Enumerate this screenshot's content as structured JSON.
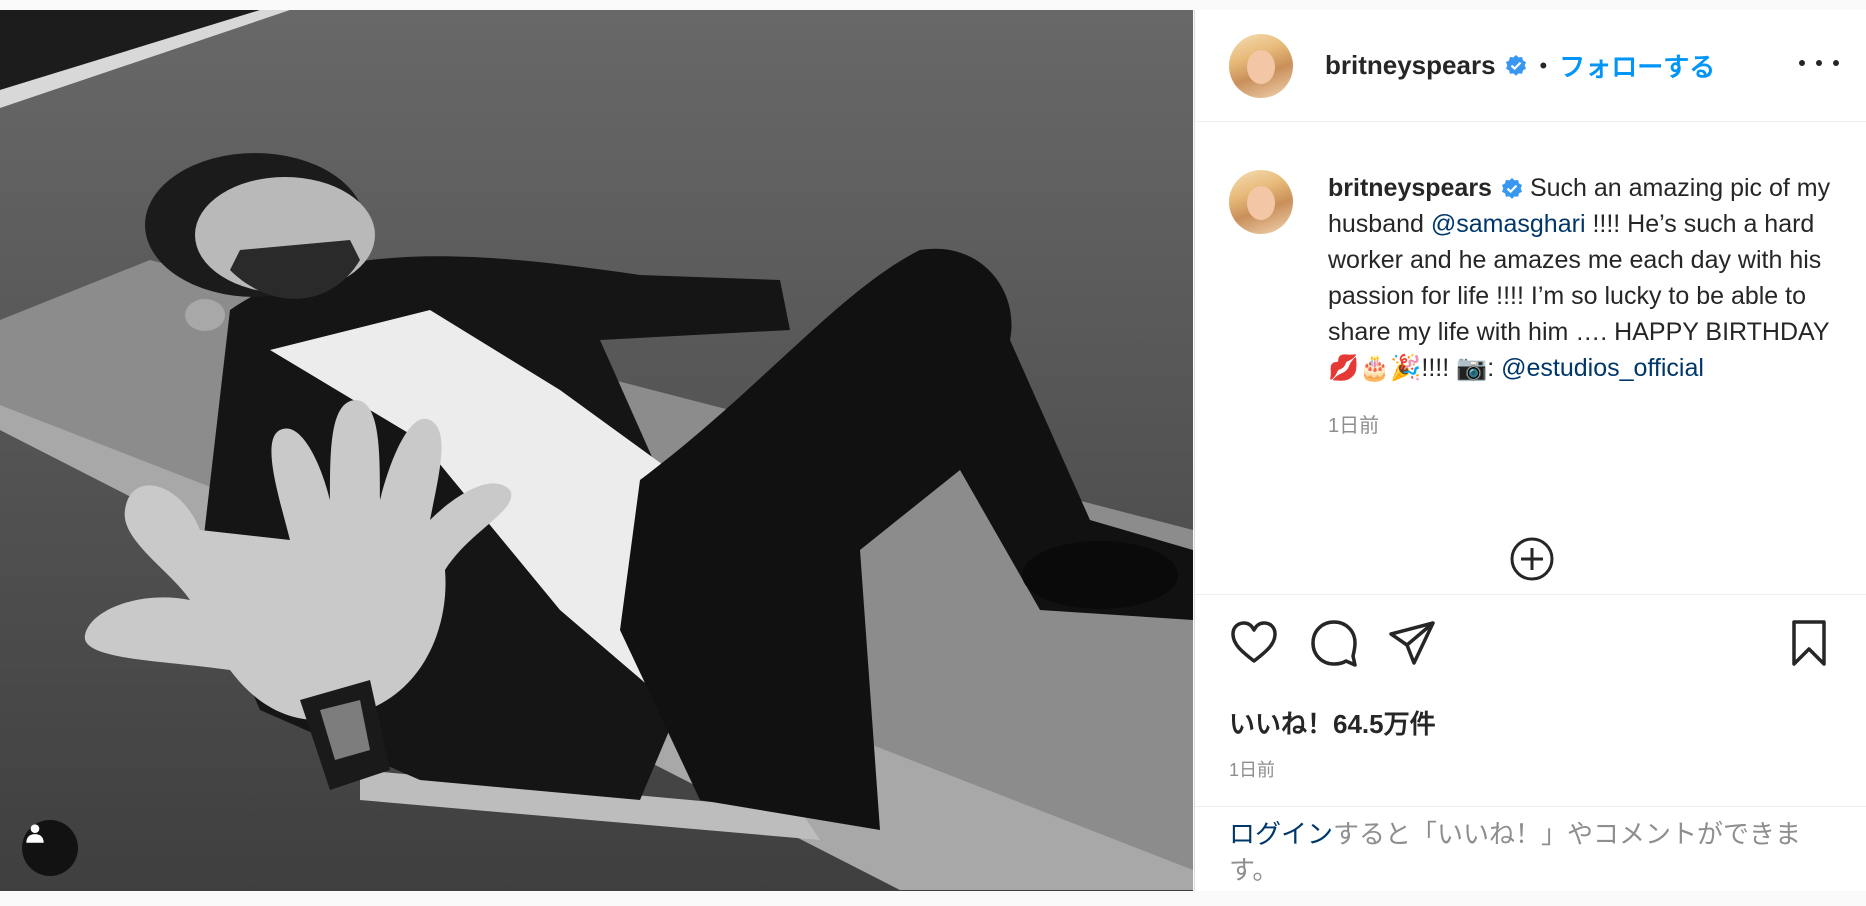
{
  "post": {
    "username": "britneyspears",
    "follow_label": "フォローする",
    "separator": "•",
    "caption": {
      "part1": "Such an amazing pic of my husband",
      "mention1": "@samasghari",
      "part2": "!!!! He’s such a hard worker and he amazes me each day with his passion for life !!!! I’m so lucky to be able to share my life with him …. HAPPY BIRTHDAY 💋🎂🎉!!!! 📷:",
      "mention2": "@estudios_official"
    },
    "caption_time": "1日前",
    "likes_label": "いいね！64.5万件",
    "post_time": "1日前",
    "login_prompt": {
      "link": "ログイン",
      "rest": "すると「いいね！」やコメントができます。"
    }
  },
  "icons": {
    "verified": "verified-badge-icon",
    "more": "more-options-icon",
    "load_more": "plus-circle-icon",
    "like": "heart-icon",
    "comment": "comment-bubble-icon",
    "share": "paper-plane-icon",
    "save": "bookmark-icon",
    "tagged_user": "user-tag-icon"
  },
  "colors": {
    "accent_blue": "#0095f6",
    "link_dark_blue": "#00376b",
    "verified_blue": "#3897f0",
    "text_primary": "#262626",
    "text_secondary": "#8e8e8e"
  }
}
